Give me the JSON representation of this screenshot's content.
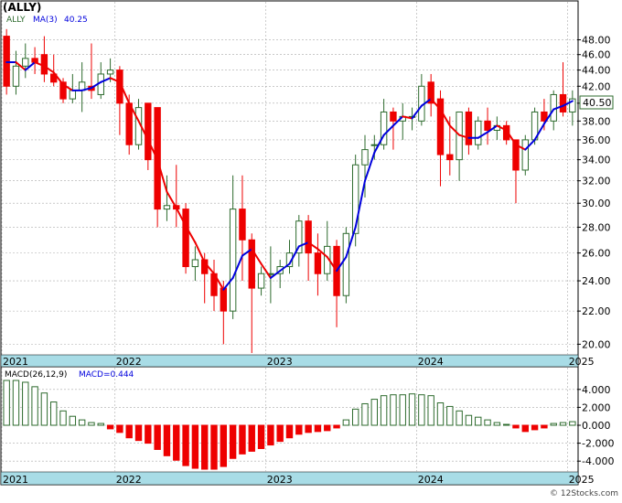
{
  "ticker": "(ALLY)",
  "price_legend": {
    "series_label": "ALLY",
    "ma_label": "MA(3)",
    "ma_value": "40.25"
  },
  "last_price_label": "40.50",
  "macd_legend": {
    "label": "MACD(26,12,9)",
    "value_label": "MACD=0.444"
  },
  "watermark": "© 12Stocks.com",
  "colors": {
    "up": "#2e6b2e",
    "down": "#ee0000",
    "ma": "#0000dd",
    "ma_down": "#ee0000",
    "axis_band": "#a8dce6",
    "grid": "#aaaaaa"
  },
  "chart_data": [
    {
      "type": "candlestick",
      "name": "ALLY",
      "ylim": [
        19.5,
        50
      ],
      "yscale": "log",
      "yticks": [
        "20.00",
        "22.00",
        "24.00",
        "26.00",
        "28.00",
        "30.00",
        "32.00",
        "34.00",
        "36.00",
        "38.00",
        "40.00",
        "42.00",
        "44.00",
        "46.00",
        "48.00"
      ],
      "x_labels": [
        "2021",
        "2022",
        "2023",
        "2024",
        "2025"
      ],
      "x_label_index": [
        0,
        12,
        28,
        44,
        60
      ],
      "grid": true,
      "candles": [
        [
          48.5,
          42.0,
          49.5,
          41.0
        ],
        [
          42.0,
          44.5,
          46.5,
          41.0
        ],
        [
          44.5,
          45.5,
          47.5,
          43.0
        ],
        [
          45.5,
          45.0,
          47.0,
          43.5
        ],
        [
          46.0,
          43.5,
          48.5,
          42.5
        ],
        [
          43.5,
          42.5,
          46.0,
          42.0
        ],
        [
          42.5,
          40.5,
          43.0,
          40.0
        ],
        [
          40.5,
          41.5,
          43.5,
          40.0
        ],
        [
          41.5,
          42.5,
          45.0,
          39.0
        ],
        [
          42.0,
          41.5,
          47.5,
          40.5
        ],
        [
          41.0,
          43.5,
          45.0,
          40.5
        ],
        [
          43.5,
          44.0,
          45.5,
          42.5
        ],
        [
          44.0,
          40.0,
          44.5,
          36.5
        ],
        [
          40.0,
          35.5,
          41.0,
          34.5
        ],
        [
          35.5,
          39.5,
          40.5,
          35.0
        ],
        [
          40.0,
          34.0,
          40.0,
          33.0
        ],
        [
          39.5,
          29.5,
          39.5,
          28.0
        ],
        [
          29.5,
          29.8,
          32.5,
          28.5
        ],
        [
          29.8,
          29.5,
          33.5,
          28.0
        ],
        [
          29.5,
          25.0,
          30.0,
          24.5
        ],
        [
          25.0,
          25.5,
          26.5,
          24.0
        ],
        [
          25.5,
          24.5,
          26.0,
          22.5
        ],
        [
          24.5,
          23.0,
          25.5,
          22.0
        ],
        [
          23.5,
          22.0,
          24.0,
          20.0
        ],
        [
          22.0,
          29.5,
          32.5,
          21.5
        ],
        [
          29.5,
          27.0,
          32.5,
          24.0
        ],
        [
          27.0,
          23.5,
          27.5,
          19.5
        ],
        [
          23.5,
          24.5,
          25.0,
          23.0
        ],
        [
          24.5,
          24.5,
          26.5,
          22.5
        ],
        [
          24.5,
          25.0,
          25.5,
          23.5
        ],
        [
          25.0,
          26.0,
          27.0,
          24.5
        ],
        [
          26.0,
          28.5,
          29.0,
          25.0
        ],
        [
          28.5,
          26.0,
          29.0,
          24.0
        ],
        [
          26.0,
          24.5,
          27.5,
          23.0
        ],
        [
          24.5,
          26.5,
          28.5,
          24.0
        ],
        [
          26.5,
          23.0,
          27.0,
          21.0
        ],
        [
          23.0,
          27.5,
          28.0,
          22.5
        ],
        [
          27.5,
          33.5,
          34.5,
          26.5
        ],
        [
          33.5,
          35.0,
          36.5,
          30.5
        ],
        [
          35.5,
          35.5,
          36.5,
          34.0
        ],
        [
          35.5,
          39.0,
          40.5,
          35.0
        ],
        [
          39.0,
          38.0,
          39.5,
          35.0
        ],
        [
          38.0,
          38.5,
          40.0,
          36.0
        ],
        [
          38.5,
          38.5,
          39.5,
          37.0
        ],
        [
          38.0,
          42.0,
          43.5,
          37.5
        ],
        [
          42.5,
          40.0,
          43.5,
          38.5
        ],
        [
          40.5,
          34.5,
          41.5,
          31.5
        ],
        [
          34.5,
          34.0,
          38.5,
          32.5
        ],
        [
          34.0,
          39.0,
          39.0,
          32.0
        ],
        [
          39.0,
          35.5,
          39.5,
          34.5
        ],
        [
          35.5,
          38.0,
          38.5,
          35.0
        ],
        [
          38.0,
          37.0,
          39.5,
          35.5
        ],
        [
          37.0,
          37.5,
          38.5,
          36.0
        ],
        [
          37.5,
          36.0,
          38.0,
          35.5
        ],
        [
          36.0,
          33.0,
          36.0,
          30.0
        ],
        [
          33.0,
          36.0,
          36.5,
          32.5
        ],
        [
          36.0,
          39.0,
          39.5,
          35.5
        ],
        [
          39.0,
          38.0,
          40.5,
          37.0
        ],
        [
          38.0,
          41.0,
          41.5,
          37.0
        ],
        [
          41.0,
          39.0,
          45.0,
          38.5
        ],
        [
          39.0,
          40.5,
          41.5,
          37.5
        ]
      ],
      "ma3": [
        45.0,
        45.0,
        44.0,
        45.0,
        44.5,
        43.7,
        42.2,
        41.5,
        41.5,
        41.8,
        42.5,
        43.0,
        42.5,
        40.0,
        38.0,
        36.0,
        34.0,
        31.0,
        29.6,
        28.1,
        26.8,
        25.3,
        24.5,
        23.4,
        24.2,
        25.8,
        26.3,
        25.2,
        24.2,
        24.7,
        25.2,
        26.5,
        26.8,
        26.3,
        25.7,
        24.7,
        25.7,
        28.0,
        32.0,
        34.7,
        36.5,
        37.5,
        38.5,
        38.3,
        39.7,
        40.5,
        39.3,
        37.5,
        36.5,
        36.2,
        36.2,
        36.8,
        37.5,
        37.0,
        35.5,
        35.0,
        36.0,
        37.7,
        39.3,
        39.7,
        40.25
      ]
    },
    {
      "type": "bar",
      "name": "MACD(26,12,9)",
      "ylim": [
        -5.0,
        5.0
      ],
      "yticks": [
        "-4.000",
        "-2.000",
        "0.000",
        "2.000",
        "4.000"
      ],
      "x_labels": [
        "2021",
        "2022",
        "2023",
        "2024",
        "2025"
      ],
      "x_label_index": [
        0,
        12,
        28,
        44,
        60
      ],
      "values": [
        5.0,
        5.0,
        4.8,
        4.3,
        3.6,
        2.6,
        1.6,
        1.0,
        0.6,
        0.3,
        0.2,
        -0.4,
        -0.8,
        -1.4,
        -1.7,
        -2.0,
        -2.7,
        -3.4,
        -3.9,
        -4.5,
        -4.8,
        -4.9,
        -4.9,
        -4.6,
        -3.7,
        -3.2,
        -2.9,
        -2.6,
        -2.2,
        -1.8,
        -1.4,
        -1.0,
        -0.8,
        -0.7,
        -0.6,
        -0.3,
        0.6,
        1.8,
        2.4,
        2.9,
        3.3,
        3.4,
        3.4,
        3.5,
        3.4,
        3.3,
        2.5,
        2.1,
        1.6,
        1.1,
        0.9,
        0.6,
        0.3,
        0.1,
        -0.3,
        -0.7,
        -0.5,
        -0.3,
        0.2,
        0.3,
        0.4
      ]
    }
  ]
}
